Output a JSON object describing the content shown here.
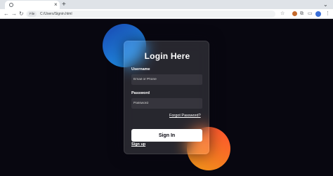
{
  "browser": {
    "new_tab_glyph": "+",
    "tab_close_glyph": "×",
    "url_chip": "File",
    "url": "C:/Users/Signin.html",
    "icons": [
      "back-icon",
      "forward-icon",
      "reload-icon",
      "star-icon",
      "extension-icon",
      "puzzle-icon",
      "split-icon",
      "profile-icon",
      "menu-icon"
    ]
  },
  "login": {
    "title": "Login Here",
    "username_label": "Username",
    "username_placeholder": "Email or Phone",
    "password_label": "Password",
    "password_placeholder": "Password",
    "forgot_link": "Forgot Password?",
    "sign_in_button": "Sign In",
    "sign_up_link": "Sign up"
  },
  "colors": {
    "background": "#080710",
    "blue_gradient": [
      "#1845ad",
      "#23a2f6"
    ],
    "orange_gradient": [
      "#ff512f",
      "#f09819"
    ]
  }
}
